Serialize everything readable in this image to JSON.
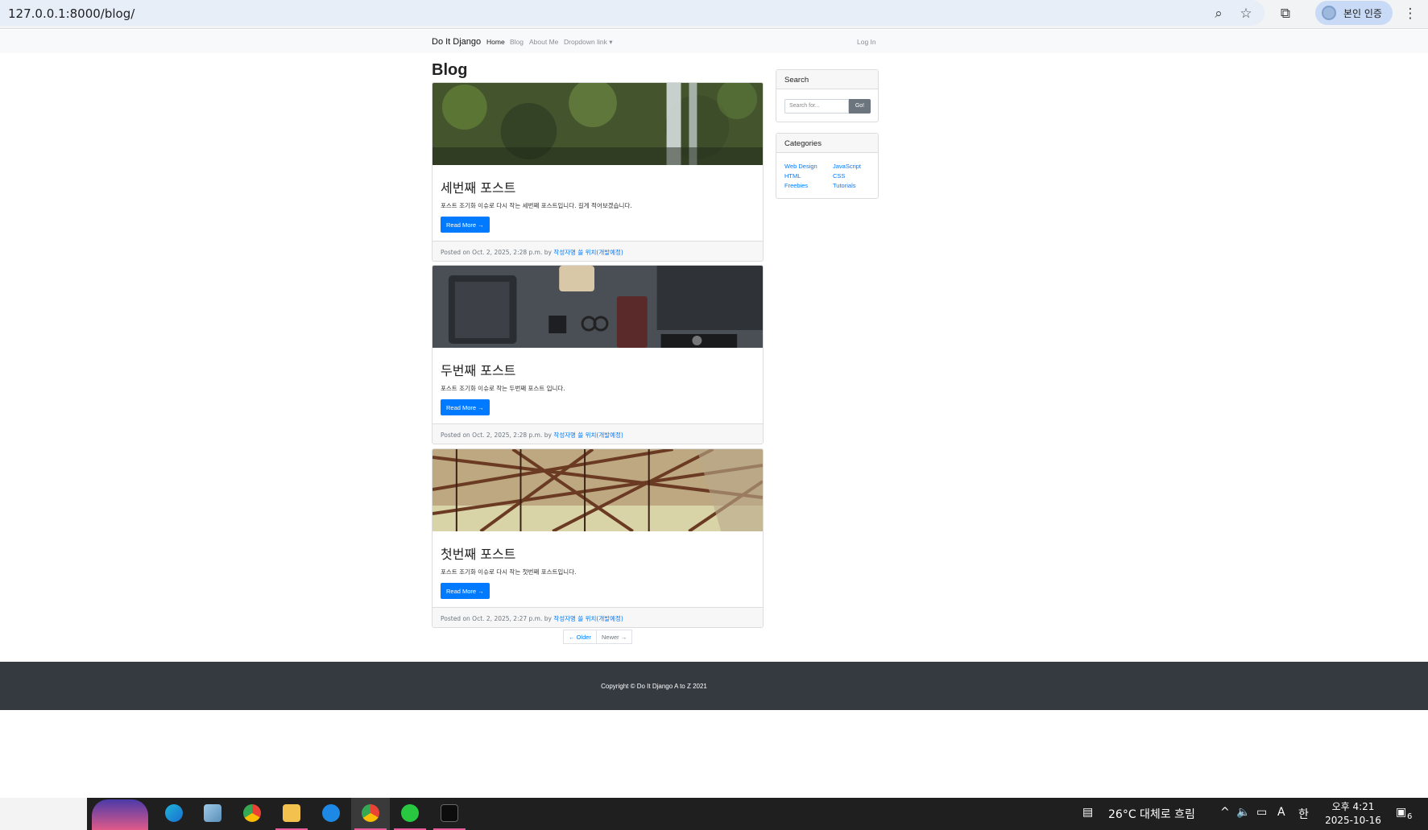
{
  "browser": {
    "url": "127.0.0.1:8000/blog/",
    "verify_label": "본인 인증"
  },
  "navbar": {
    "brand": "Do It Django",
    "links": [
      "Home",
      "Blog",
      "About Me",
      "Dropdown link ▾"
    ],
    "login": "Log In"
  },
  "main": {
    "title": "Blog",
    "posts": [
      {
        "title": "세번째 포스트",
        "excerpt": "포스트 조기화 이슈로 다시 작는 세번째 포스트입니다. 길게 적어보겠습니다.",
        "read_more": "Read More →",
        "posted": "Posted on Oct. 2, 2025, 2:28 p.m. by ",
        "author": "작성자명 쓸 위치(개발예정)"
      },
      {
        "title": "두번째 포스트",
        "excerpt": "포스트 조기화 이슈로 작는 두번째 포스트 입니다.",
        "read_more": "Read More →",
        "posted": "Posted on Oct. 2, 2025, 2:28 p.m. by ",
        "author": "작성자명 쓸 위치(개발예정)"
      },
      {
        "title": "첫번째 포스트",
        "excerpt": "포스트 조기화 이슈로 다시 작는 첫번째 포스트입니다.",
        "read_more": "Read More →",
        "posted": "Posted on Oct. 2, 2025, 2:27 p.m. by ",
        "author": "작성자명 쓸 위치(개발예정)"
      }
    ],
    "pager": {
      "older": "← Older",
      "newer": "Newer →"
    }
  },
  "sidebar": {
    "search_title": "Search",
    "search_placeholder": "Search for...",
    "search_button": "Go!",
    "categories_title": "Categories",
    "categories": [
      "Web Design",
      "HTML",
      "Freebies",
      "JavaScript",
      "CSS",
      "Tutorials"
    ]
  },
  "footer": {
    "copyright": "Copyright © Do It Django A to Z 2021"
  },
  "taskbar": {
    "weather": "26°C  대체로 흐림",
    "time": "오후 4:21",
    "date": "2025-10-16",
    "notification_count": "6"
  }
}
